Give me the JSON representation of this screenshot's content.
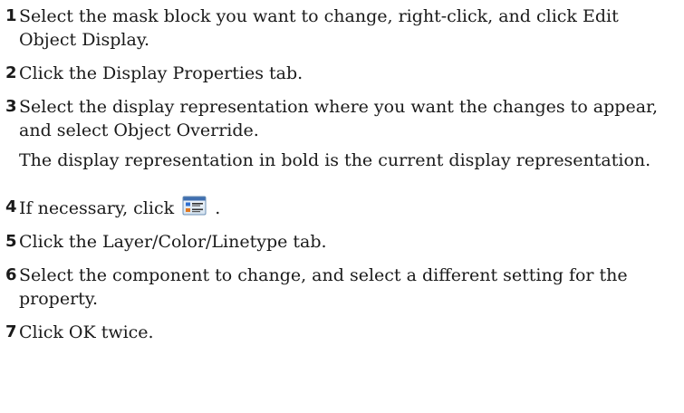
{
  "steps": [
    {
      "num": "1",
      "text": "Select the mask block you want to change, right-click, and click Edit Object Display."
    },
    {
      "num": "2",
      "text": "Click the Display Properties tab."
    },
    {
      "num": "3",
      "text": "Select the display representation where you want the changes to appear, and select Object Override."
    },
    {
      "note": "The display representation in bold is the current display representation."
    },
    {
      "num": "4",
      "text_before": "If necessary, click",
      "text_after": ".",
      "icon": "edit-display-properties-icon"
    },
    {
      "num": "5",
      "text": "Click the Layer/Color/Linetype tab."
    },
    {
      "num": "6",
      "text": "Select the component to change, and select a different setting for the property."
    },
    {
      "num": "7",
      "text": "Click OK twice."
    }
  ]
}
